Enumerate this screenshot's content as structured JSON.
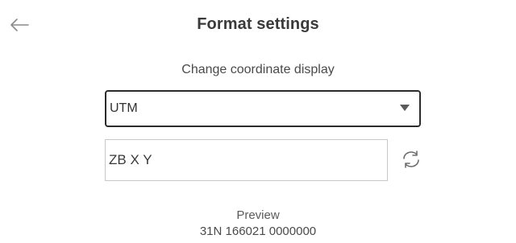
{
  "header": {
    "title": "Format settings",
    "back_icon": "arrow-left-icon"
  },
  "format": {
    "heading": "Change coordinate display",
    "selected_format": "UTM",
    "pattern_value": "ZB X Y",
    "reset_icon": "refresh-icon"
  },
  "preview": {
    "label": "Preview",
    "value": "31N 166021 0000000"
  }
}
